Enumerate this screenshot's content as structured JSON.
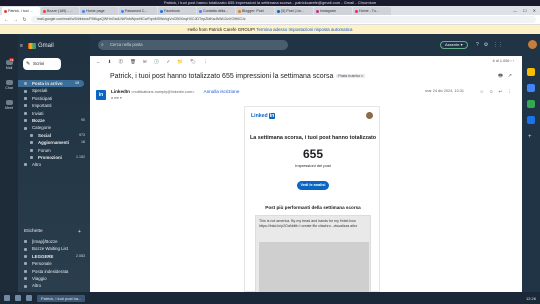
{
  "window": {
    "title": "Patrick, i tuoi post hanno totalizzato 655 impressioni la settimana scorsa - patrickcarefe@gmail.com - Gmail - Chromium",
    "controls": [
      "—",
      "☐",
      "✕"
    ]
  },
  "tabs": [
    {
      "label": "Patrick, i tuoi ...",
      "color": "#ea4335"
    },
    {
      "label": "Bozze (189) - ...",
      "color": "#ea4335"
    },
    {
      "label": "Home page",
      "color": "#4285f4"
    },
    {
      "label": "Password C...",
      "color": "#4285f4"
    },
    {
      "label": "Facebook",
      "color": "#1877f2"
    },
    {
      "label": "Contatta della...",
      "color": "#4285f4"
    },
    {
      "label": "Blogger: Post",
      "color": "#f57c00"
    },
    {
      "label": "(5) Post | Lin...",
      "color": "#0a66c2"
    },
    {
      "label": "Instagram",
      "color": "#c13584"
    },
    {
      "label": "Home - Tu...",
      "color": "#e1306c"
    }
  ],
  "address": {
    "back": "←",
    "forward": "→",
    "reload": "↻",
    "url": "mail.google.com/mail/u/0/#inbox/FMfcgzQWHnGsdLNrRnbWpwHlCwFqrxMSWchgVnCB0XnqHXCJDTnpZbtKwJbWLDzVG9t0GJc"
  },
  "banner": {
    "text": "Hello from Patrick Carefe GROUP!",
    "link1": "Termina adesso",
    "link2": "Impostazioni risposta automatica"
  },
  "rail": {
    "mail_label": "Mail",
    "mail_badge": "19",
    "chat_label": "Chat",
    "meet_label": "Meet"
  },
  "sidebar": {
    "menu_icon": "≡",
    "app_name": "Gmail",
    "compose_label": "Scrivi",
    "items": [
      {
        "label": "Posta in arrivo",
        "count": "19"
      },
      {
        "label": "Speciali",
        "count": ""
      },
      {
        "label": "Posticipati",
        "count": ""
      },
      {
        "label": "Importanti",
        "count": ""
      },
      {
        "label": "Inviati",
        "count": ""
      },
      {
        "label": "Bozze",
        "count": "90"
      },
      {
        "label": "Categorie",
        "count": ""
      },
      {
        "label": "Social",
        "count": "973"
      },
      {
        "label": "Aggiornamenti",
        "count": "18"
      },
      {
        "label": "Forum",
        "count": ""
      },
      {
        "label": "Promozioni",
        "count": "1.152"
      },
      {
        "label": "Altro",
        "count": ""
      }
    ],
    "labels_header": "Etichette",
    "labels_add": "+",
    "labels": [
      {
        "label": "[Imap]/Bozze",
        "count": ""
      },
      {
        "label": "Bozze Waiting List",
        "count": ""
      },
      {
        "label": "LEGGERE",
        "count": "2.083"
      },
      {
        "label": "Personale",
        "count": ""
      },
      {
        "label": "Posta indesiderata",
        "count": ""
      },
      {
        "label": "Viaggio",
        "count": ""
      },
      {
        "label": "Altro",
        "count": ""
      }
    ]
  },
  "topbar": {
    "search_placeholder": "Cerca nella posta",
    "assist_label": "Assente ▾",
    "icons": [
      "?",
      "⚙",
      "⋮⋮"
    ]
  },
  "toolbar": {
    "icons": [
      "←",
      "⬇",
      "⓵",
      "🗑",
      "✉",
      "🕓",
      "✓",
      "📁",
      "🏷",
      "⋮"
    ],
    "pager": "6 di 1.006  ‹  ›"
  },
  "message": {
    "subject": "Patrick, i tuoi post hanno totalizzato 655 impressioni la settimana scorsa",
    "tag": "Posta in arrivo ×",
    "subject_icons": [
      "🖶",
      "↗"
    ],
    "sender_initial": "in",
    "sender_name": "LinkedIn",
    "sender_addr": "<notifications-noreply@linkedin.com>",
    "unsubscribe": "Annulla iscrizione",
    "to": "a me ▾",
    "date": "mar 24 dic 2024, 10:31",
    "icons": [
      "☆",
      "☺",
      "↩",
      "⋮"
    ]
  },
  "email": {
    "logo_text": "Linked",
    "logo_in": "in",
    "headline": "La settimana scorsa, i tuoi post hanno totalizzato",
    "big_number": "655",
    "big_label": "Impressioni dei post",
    "button": "Vedi le analisi",
    "section_title": "Post più performanti della settimana scorsa",
    "post_text": "This is not america. By my head and hands for my Hotel.how https://lnkd.in/p2GaNdtfn I create file citachro...visualizza altro"
  },
  "right_panel": {
    "colors": [
      "#fbbc04",
      "#4285f4",
      "#34a853",
      "#1a73e8"
    ],
    "add": "+"
  },
  "taskbar": {
    "window_label": "Patrick, i tuoi post ha...",
    "clock": "12:26"
  }
}
